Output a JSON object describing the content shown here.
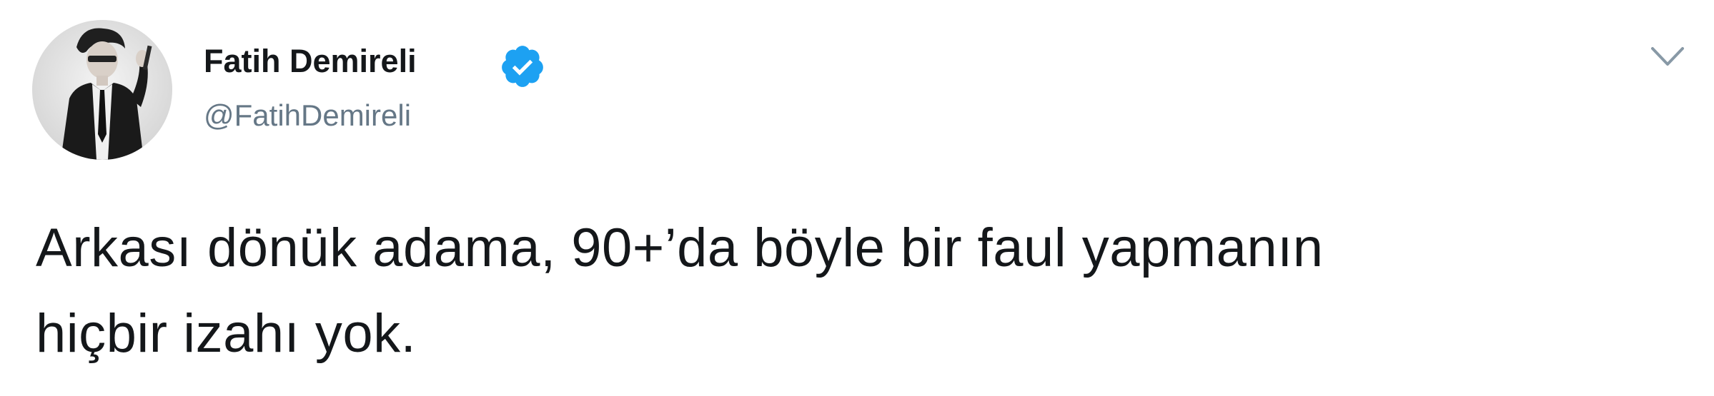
{
  "tweet": {
    "author": {
      "display_name": "Fatih Demireli",
      "handle": "@FatihDemireli",
      "verified": true,
      "avatar_icon": "profile-photo"
    },
    "text_lines": [
      "Arkası dönük adama, 90+’da böyle bir faul yapmanın",
      "hiçbir izahı yok."
    ],
    "menu_icon": "chevron-down-icon",
    "colors": {
      "verified_badge": "#1da1f2",
      "handle_text": "#657786",
      "body_text": "#14171a",
      "background": "#ffffff"
    }
  }
}
